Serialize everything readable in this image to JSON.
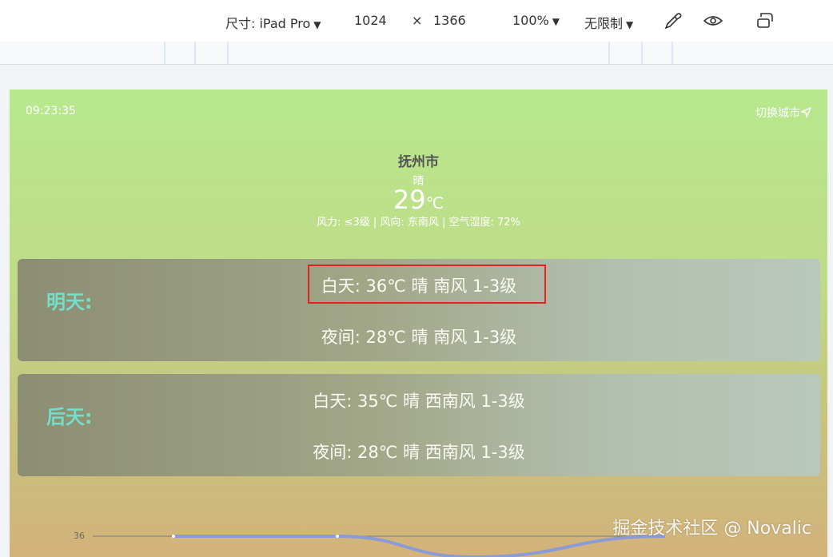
{
  "toolbar": {
    "dimensions_label": "尺寸: iPad Pro",
    "width": "1024",
    "times": "×",
    "height": "1366",
    "zoom": "100%",
    "throttle": "无限制",
    "caret": "▼",
    "icons": [
      "eyedropper-icon",
      "eye-icon",
      "rotate-icon"
    ]
  },
  "app": {
    "time": "09:23:35",
    "switch_city": "切换城市",
    "city": "抚州市",
    "condition": "晴",
    "temperature": "29",
    "unit": "℃",
    "meta": "风力: ≤3级 | 风向: 东南风 | 空气湿度: 72%"
  },
  "forecast": [
    {
      "title": "明天:",
      "day": "白天:  36℃ 晴 南风 1-3级",
      "night": "夜间:  28℃ 晴 南风 1-3级"
    },
    {
      "title": "后天:",
      "day": "白天: 35℃ 晴 西南风 1-3级",
      "night": "夜间: 28℃ 晴 西南风 1-3级"
    }
  ],
  "chart_data": {
    "type": "line",
    "y_tick": "36",
    "values": [
      36,
      36,
      35,
      36
    ]
  },
  "watermark": "掘金技术社区 @ Novalic"
}
